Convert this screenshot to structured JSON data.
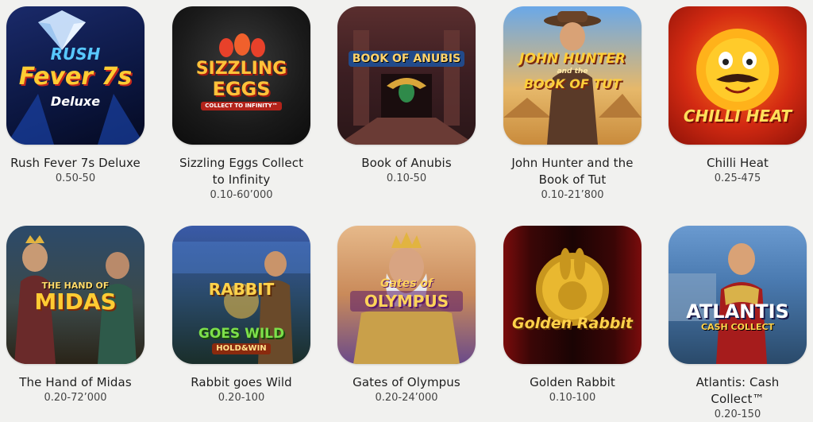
{
  "games": [
    {
      "name": "Rush Fever 7s Deluxe",
      "range": "0.50-50",
      "logo": [
        "RUSH",
        "Fever 7s",
        "Deluxe"
      ]
    },
    {
      "name": "Sizzling Eggs Collect to Infinity",
      "range": "0.10-60’000",
      "logo": [
        "SIZZLING",
        "EGGS",
        "COLLECT TO INFINITY™"
      ]
    },
    {
      "name": "Book of Anubis",
      "range": "0.10-50",
      "logo": [
        "BOOK OF ANUBIS"
      ]
    },
    {
      "name": "John Hunter and the Book of Tut",
      "range": "0.10-21’800",
      "logo": [
        "JOHN HUNTER",
        "and the",
        "BOOK OF TUT"
      ]
    },
    {
      "name": "Chilli Heat",
      "range": "0.25-475",
      "logo": [
        "CHILLI HEAT"
      ]
    },
    {
      "name": "The Hand of Midas",
      "range": "0.20-72’000",
      "logo": [
        "THE HAND OF",
        "MIDAS"
      ]
    },
    {
      "name": "Rabbit goes Wild",
      "range": "0.20-100",
      "logo": [
        "RABBIT",
        "GOES WILD",
        "HOLD&WIN"
      ]
    },
    {
      "name": "Gates of Olympus",
      "range": "0.20-24’000",
      "logo": [
        "Gates of",
        "OLYMPUS"
      ]
    },
    {
      "name": "Golden Rabbit",
      "range": "0.10-100",
      "logo": [
        "Golden Rabbit"
      ]
    },
    {
      "name": "Atlantis: Cash Collect™",
      "range": "0.20-150",
      "logo": [
        "ATLANTIS",
        "CASH COLLECT"
      ]
    }
  ]
}
